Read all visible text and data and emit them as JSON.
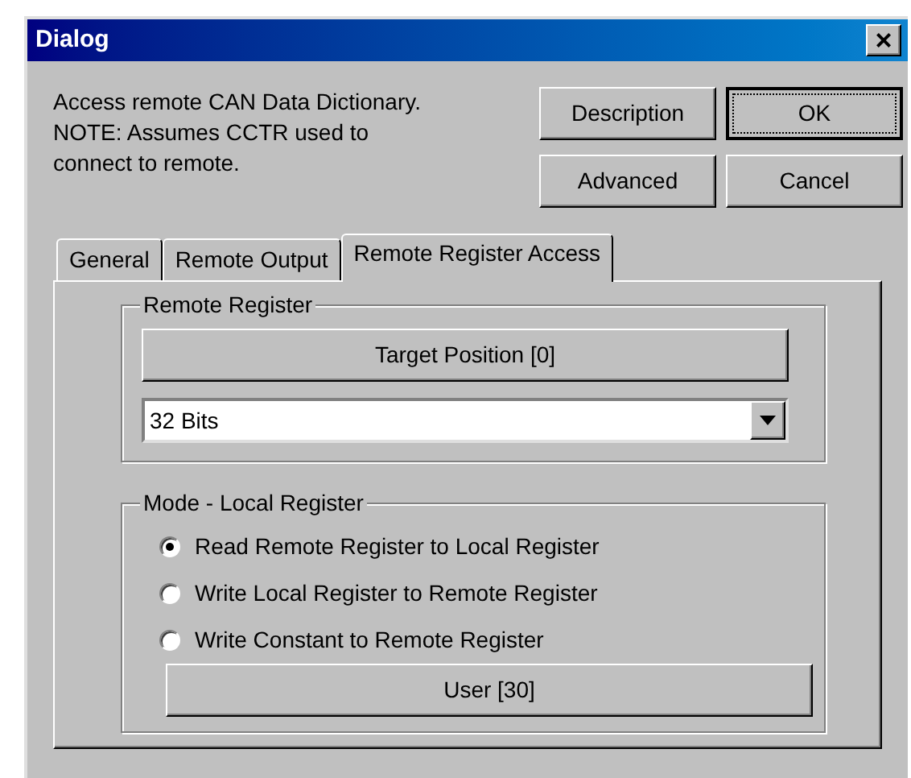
{
  "window": {
    "title": "Dialog",
    "close": "×"
  },
  "description": "Access remote CAN Data Dictionary.\nNOTE:  Assumes CCTR used to\nconnect to remote.",
  "buttons": [
    {
      "label": "Description",
      "default": false
    },
    {
      "label": "OK",
      "default": true
    },
    {
      "label": "Advanced",
      "default": false
    },
    {
      "label": "Cancel",
      "default": false
    }
  ],
  "tabs": [
    {
      "label": "General",
      "selected": false
    },
    {
      "label": "Remote Output",
      "selected": false
    },
    {
      "label": "Remote Register Access",
      "selected": true
    }
  ],
  "remote_register": {
    "title": "Remote Register",
    "button": "Target Position [0]",
    "select": {
      "value": "32 Bits"
    }
  },
  "mode": {
    "title": "Mode - Local Register",
    "options": [
      {
        "label": "Read Remote Register to Local Register",
        "selected": true
      },
      {
        "label": "Write Local Register to Remote Register",
        "selected": false
      },
      {
        "label": "Write Constant to Remote Register",
        "selected": false
      }
    ],
    "button": "User [30]"
  }
}
